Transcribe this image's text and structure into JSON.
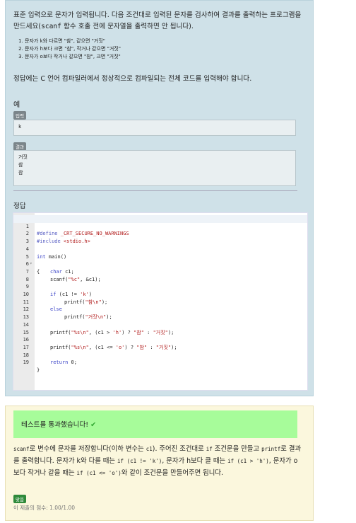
{
  "question": {
    "intro_part1": "표준 입력으로 문자가 입력됩니다. 다음 조건대로 입력된 문자를 검사하여 결과를 출력하는 프로그램을 만드세요(",
    "intro_code": "scanf",
    "intro_part2": " 함수 호출 전에 문자열을 출력하면 안 됩니다).",
    "conditions": [
      "문자가 k와 다르면 \"참\", 같으면 \"거짓\"",
      "문자가 h보다 크면 \"참\", 작거나 같으면 \"거짓\"",
      "문자가 o보다 작거나 같으면 \"참\", 크면 \"거짓\""
    ],
    "requirement": "정답에는 C 언어 컴파일러에서 정상적으로 컴파일되는 전체 코드를 입력해야 합니다."
  },
  "example": {
    "title": "예",
    "input_badge": "입력",
    "input_value": "k",
    "output_badge": "결과",
    "output_lines": [
      "거짓",
      "참",
      "참"
    ]
  },
  "answer": {
    "title": "정답",
    "line_numbers": [
      "1",
      "2",
      "3",
      "4",
      "5",
      "6",
      "7",
      "8",
      "9",
      "10",
      "11",
      "12",
      "13",
      "14",
      "15",
      "16",
      "17",
      "18",
      "19"
    ],
    "fold_marker": "▾",
    "lines": {
      "l1_kw": "#define",
      "l1_def": " _CRT_SECURE_NO_WARNINGS",
      "l2_kw": "#include",
      "l2_hdr": " <stdio.h>",
      "l4_kw": "int",
      "l4_rest": " main()",
      "l5": "{",
      "l6_kw": "char",
      "l6_rest": " c1;",
      "l7_a": "scanf(",
      "l7_s": "\"%c\"",
      "l7_b": ", &c1);",
      "l9_kw": "if",
      "l9_a": " (c1 != ",
      "l9_s": "'k'",
      "l9_b": ")",
      "l10_a": "printf(",
      "l10_s": "\"참\\n\"",
      "l10_b": ");",
      "l11_kw": "else",
      "l12_a": "printf(",
      "l12_s": "\"거짓\\n\"",
      "l12_b": ");",
      "l14_a": "printf(",
      "l14_s1": "\"%s\\n\"",
      "l14_b": ", (c1 > ",
      "l14_s2": "'h'",
      "l14_c": ") ? ",
      "l14_s3": "\"참\"",
      "l14_d": " : ",
      "l14_s4": "\"거짓\"",
      "l14_e": ");",
      "l16_a": "printf(",
      "l16_s1": "\"%s\\n\"",
      "l16_b": ", (c1 <= ",
      "l16_s2": "'o'",
      "l16_c": ") ? ",
      "l16_s3": "\"참\"",
      "l16_d": " : ",
      "l16_s4": "\"거짓\"",
      "l16_e": ");",
      "l18_kw": "return",
      "l18_rest": " 0;",
      "l19": "}"
    }
  },
  "feedback": {
    "pass_message": "테스트를 통과했습니다!",
    "check_icon": "✔",
    "expl": {
      "c1": "scanf",
      "t1": "로 변수에 문자를 저장합니다(이하 변수는 ",
      "c2": "c1",
      "t2": "). 주어진 조건대로 ",
      "c3": "if",
      "t3": " 조건문을 만들고 ",
      "c4": "printf",
      "t4": "로 결과를 출력합니다. 문자가 k와 다를 때는 ",
      "c5": "if (c1 != 'k')",
      "t5": ", 문자가 h보다 클 때는 ",
      "c6": "if (c1 > 'h')",
      "t6": ", 문자가 o보다 작거나 같을 때는 ",
      "c7": "if (c1 <= 'o')",
      "t7": "와 같이 조건문을 만들어주면 됩니다."
    },
    "correct_badge": "맞음",
    "score_text": "이 제출의 점수: 1.00/1.00"
  },
  "colors": {
    "question_bg": "#cfe1e8",
    "pass_bg": "#a7fc9a",
    "feedback_bg": "#fbf7dd",
    "keyword": "#3a43c7",
    "string": "#b11a1a"
  }
}
